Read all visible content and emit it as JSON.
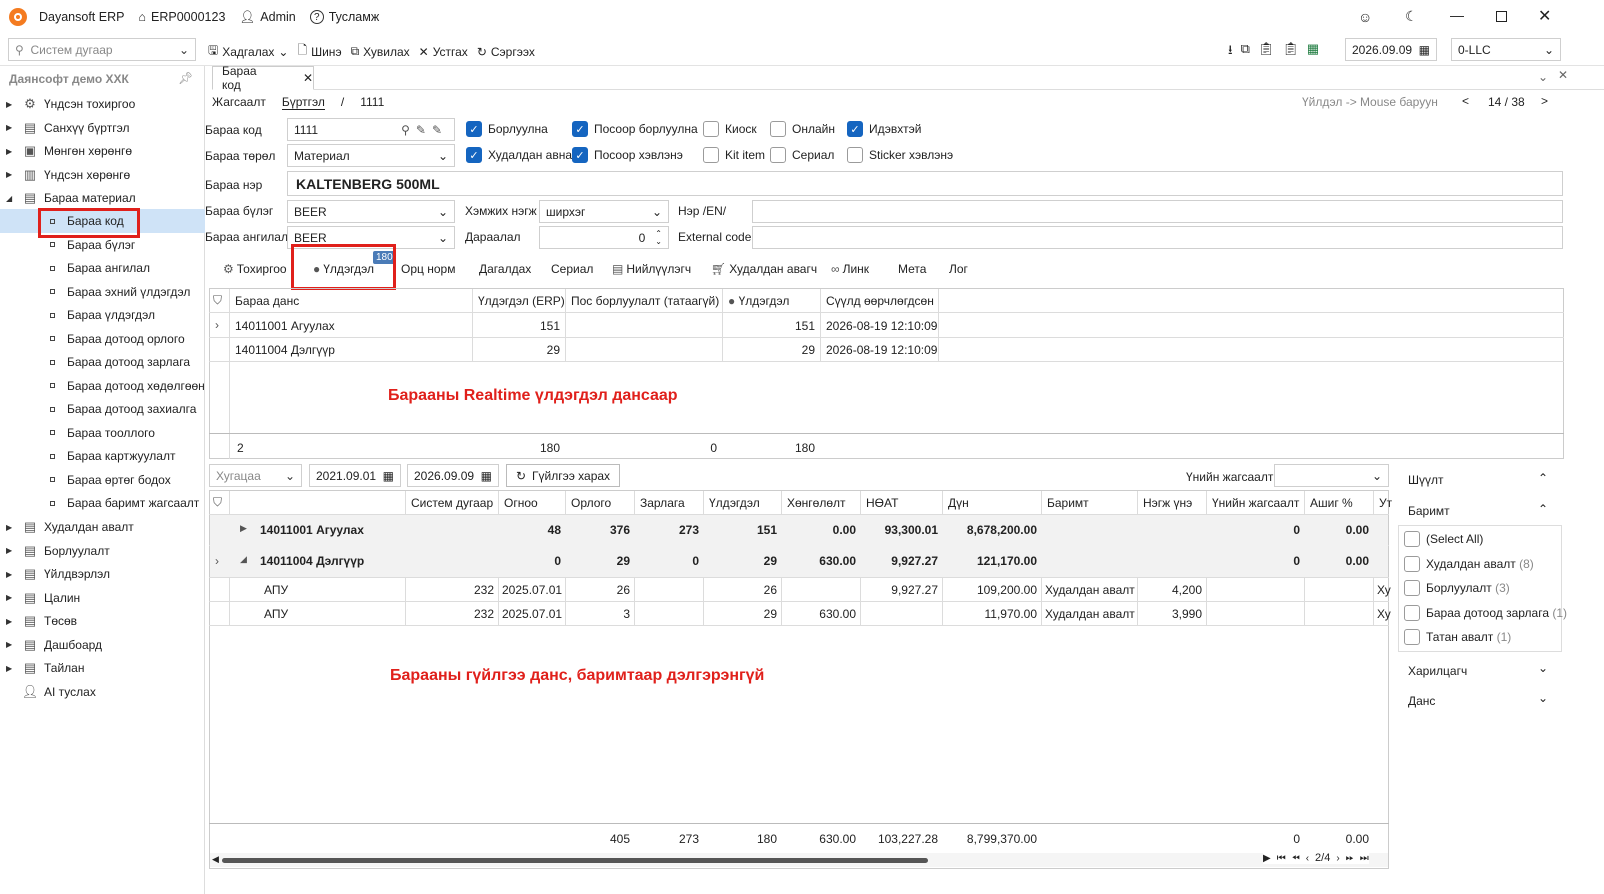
{
  "app": {
    "title": "Dayansoft ERP",
    "doc": "ERP0000123",
    "user": "Admin",
    "help": "Тусламж"
  },
  "toolbar": {
    "search_placeholder": "Систем дугаар",
    "save": "Хадгалах",
    "new": "Шинэ",
    "copy": "Хувилах",
    "delete": "Устгах",
    "refresh": "Сэргээх",
    "date": "2026.09.09",
    "company": "0-LLC"
  },
  "sidebar": {
    "company": "Даянсофт демо ХХК",
    "top": [
      "Үндсэн тохиргоо",
      "Санхүү бүртгэл",
      "Мөнгөн хөрөнгө",
      "Үндсэн хөрөнгө",
      "Бараа материал"
    ],
    "sub": [
      "Бараа код",
      "Бараа бүлэг",
      "Бараа ангилал",
      "Бараа эхний үлдэгдэл",
      "Бараа үлдэгдэл",
      "Бараа дотоод орлого",
      "Бараа дотоод зарлага",
      "Бараа дотоод хөдөлгөөн",
      "Бараа дотоод захиалга",
      "Бараа тооллого",
      "Бараа картжуулалт",
      "Бараа өртөг бодох",
      "Бараа баримт жагсаалт"
    ],
    "bottom": [
      "Худалдан авалт",
      "Борлуулалт",
      "Үйлдвэрлэл",
      "Цалин",
      "Төсөв",
      "Дашбоард",
      "Тайлан",
      "AI туслах"
    ]
  },
  "tabbar": {
    "active": "Бараа код"
  },
  "crumb": {
    "list": "Жагсаалт",
    "reg": "Бүртгэл",
    "sep": "/",
    "code": "1111",
    "hint": "Үйлдэл -> Mouse баруун",
    "prev": "<",
    "pos": "14 / 38",
    "next": ">"
  },
  "form": {
    "code_label": "Бараа код",
    "code": "1111",
    "type_label": "Бараа төрөл",
    "type": "Материал",
    "name_label": "Бараа нэр",
    "name": "KALTENBERG 500ML",
    "group_label": "Бараа бүлэг",
    "group": "BEER",
    "class_label": "Бараа ангилал",
    "class": "BEER",
    "unit_label": "Хэмжих нэгж",
    "unit": "ширхэг",
    "order_label": "Дараалал",
    "order": "0",
    "en_label": "Нэр /EN/",
    "ext_label": "External code"
  },
  "checks": [
    {
      "label": "Борлуулна",
      "on": true
    },
    {
      "label": "Посоор борлуулна",
      "on": true
    },
    {
      "label": "Киоск",
      "on": false
    },
    {
      "label": "Онлайн",
      "on": false
    },
    {
      "label": "Идэвхтэй",
      "on": true
    },
    {
      "label": "Худалдан авна",
      "on": true
    },
    {
      "label": "Посоор хэвлэнэ",
      "on": true
    },
    {
      "label": "Kit item",
      "on": false
    },
    {
      "label": "Сериал",
      "on": false
    },
    {
      "label": "Sticker хэвлэнэ",
      "on": false
    }
  ],
  "tabs": [
    "Тохиргоо",
    "Үлдэгдэл",
    "Орц норм",
    "Дагалдах",
    "Сериал",
    "Нийлүүлэгч",
    "Худалдан авагч",
    "Линк",
    "Мета",
    "Лог"
  ],
  "tab_badge": "180",
  "stock": {
    "headers": [
      "Бараа данс",
      "Үлдэгдэл (ERP)",
      "Пос борлуулалт (татаагүй)",
      "Үлдэгдэл",
      "Сүүлд өөрчлөгдсөн"
    ],
    "rows": [
      [
        "14011001 Агуулах",
        "151",
        "",
        "151",
        "2026-08-19 12:10:09"
      ],
      [
        "14011004 Дэлгүүр",
        "29",
        "",
        "29",
        "2026-08-19 12:10:09"
      ]
    ],
    "footer": [
      "2",
      "180",
      "0",
      "180"
    ],
    "note": "Барааны Realtime үлдэгдэл дансаар"
  },
  "trans": {
    "period": "Хугацаа",
    "from": "2021.09.01",
    "to": "2026.09.09",
    "btn": "Гүйлгээ харах",
    "price_label": "Үнийн жагсаалт",
    "headers": [
      "Систем дугаар",
      "Огноо",
      "Орлого",
      "Зарлага",
      "Үлдэгдэл",
      "Хөнгөлөлт",
      "НӨАТ",
      "Дүн",
      "Баримт",
      "Нэгж үнэ",
      "Үнийн жагсаалт",
      "Ашиг %",
      "Ут"
    ],
    "groups": [
      {
        "name": "14011001 Агуулах",
        "v": [
          "48",
          "376",
          "273",
          "151",
          "0.00",
          "93,300.01",
          "8,678,200.00",
          "0",
          "0.00"
        ]
      },
      {
        "name": "14011004 Дэлгүүр",
        "v": [
          "0",
          "29",
          "0",
          "29",
          "630.00",
          "9,927.27",
          "121,170.00",
          "0",
          "0.00"
        ]
      }
    ],
    "rows": [
      [
        "АПУ",
        "232",
        "2025.07.01",
        "26",
        "",
        "26",
        "",
        "9,927.27",
        "109,200.00",
        "Худалдан авалт",
        "4,200",
        "",
        "",
        "Ху"
      ],
      [
        "АПУ",
        "232",
        "2025.07.01",
        "3",
        "",
        "29",
        "630.00",
        "",
        "11,970.00",
        "Худалдан авалт",
        "3,990",
        "",
        "",
        "Ху"
      ]
    ],
    "footer": [
      "405",
      "273",
      "180",
      "630.00",
      "103,227.28",
      "8,799,370.00",
      "0",
      "0.00"
    ],
    "note": "Барааны гүйлгээ данс, баримтаар дэлгэрэнгүй",
    "pager": "2/4"
  },
  "filter": {
    "title": "Шүүлт",
    "doc": "Баримт",
    "items": [
      {
        "label": "(Select All)",
        "count": ""
      },
      {
        "label": "Худалдан авалт",
        "count": "(8)"
      },
      {
        "label": "Борлуулалт",
        "count": "(3)"
      },
      {
        "label": "Бараа дотоод зарлага",
        "count": "(1)"
      },
      {
        "label": "Татан авалт",
        "count": "(1)"
      }
    ],
    "partner": "Харилцагч",
    "account": "Данс"
  },
  "colors": {
    "accent": "#1565c0",
    "highlight": "#e0201b",
    "selected": "#cfe3f7"
  }
}
